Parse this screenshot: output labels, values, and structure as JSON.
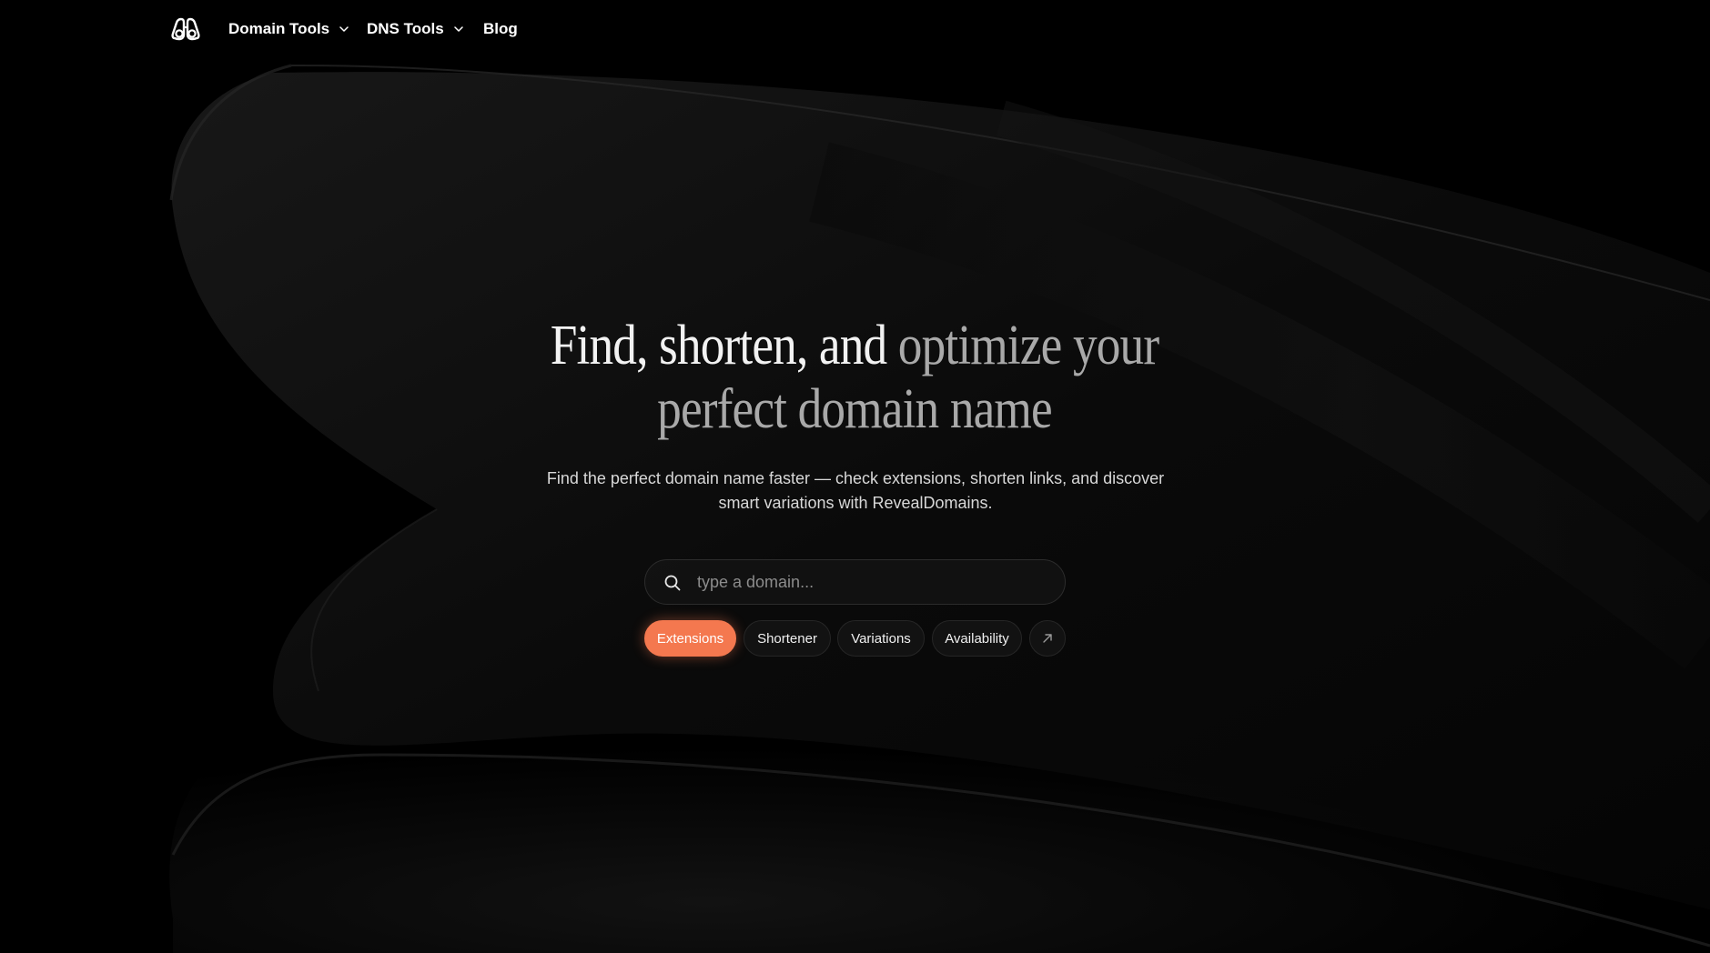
{
  "nav": {
    "logo_icon": "binoculars-icon",
    "items": [
      {
        "label": "Domain Tools",
        "has_dropdown": true
      },
      {
        "label": "DNS Tools",
        "has_dropdown": true
      },
      {
        "label": "Blog",
        "has_dropdown": false
      }
    ]
  },
  "hero": {
    "title_strong": "Find, shorten, and ",
    "title_soft": "optimize your",
    "title_line2": "perfect domain name",
    "subtitle": "Find the perfect domain name faster — check extensions, shorten links, and discover smart variations with RevealDomains."
  },
  "search": {
    "placeholder": "type a domain...",
    "value": "",
    "icon": "search-icon"
  },
  "chips": [
    {
      "label": "Extensions",
      "active": true
    },
    {
      "label": "Shortener",
      "active": false
    },
    {
      "label": "Variations",
      "active": false
    },
    {
      "label": "Availability",
      "active": false
    }
  ],
  "more_icon": "arrow-up-right-icon",
  "colors": {
    "background": "#000000",
    "accent": "#f4784f",
    "text": "#ffffff",
    "muted": "#a9a9a9"
  }
}
